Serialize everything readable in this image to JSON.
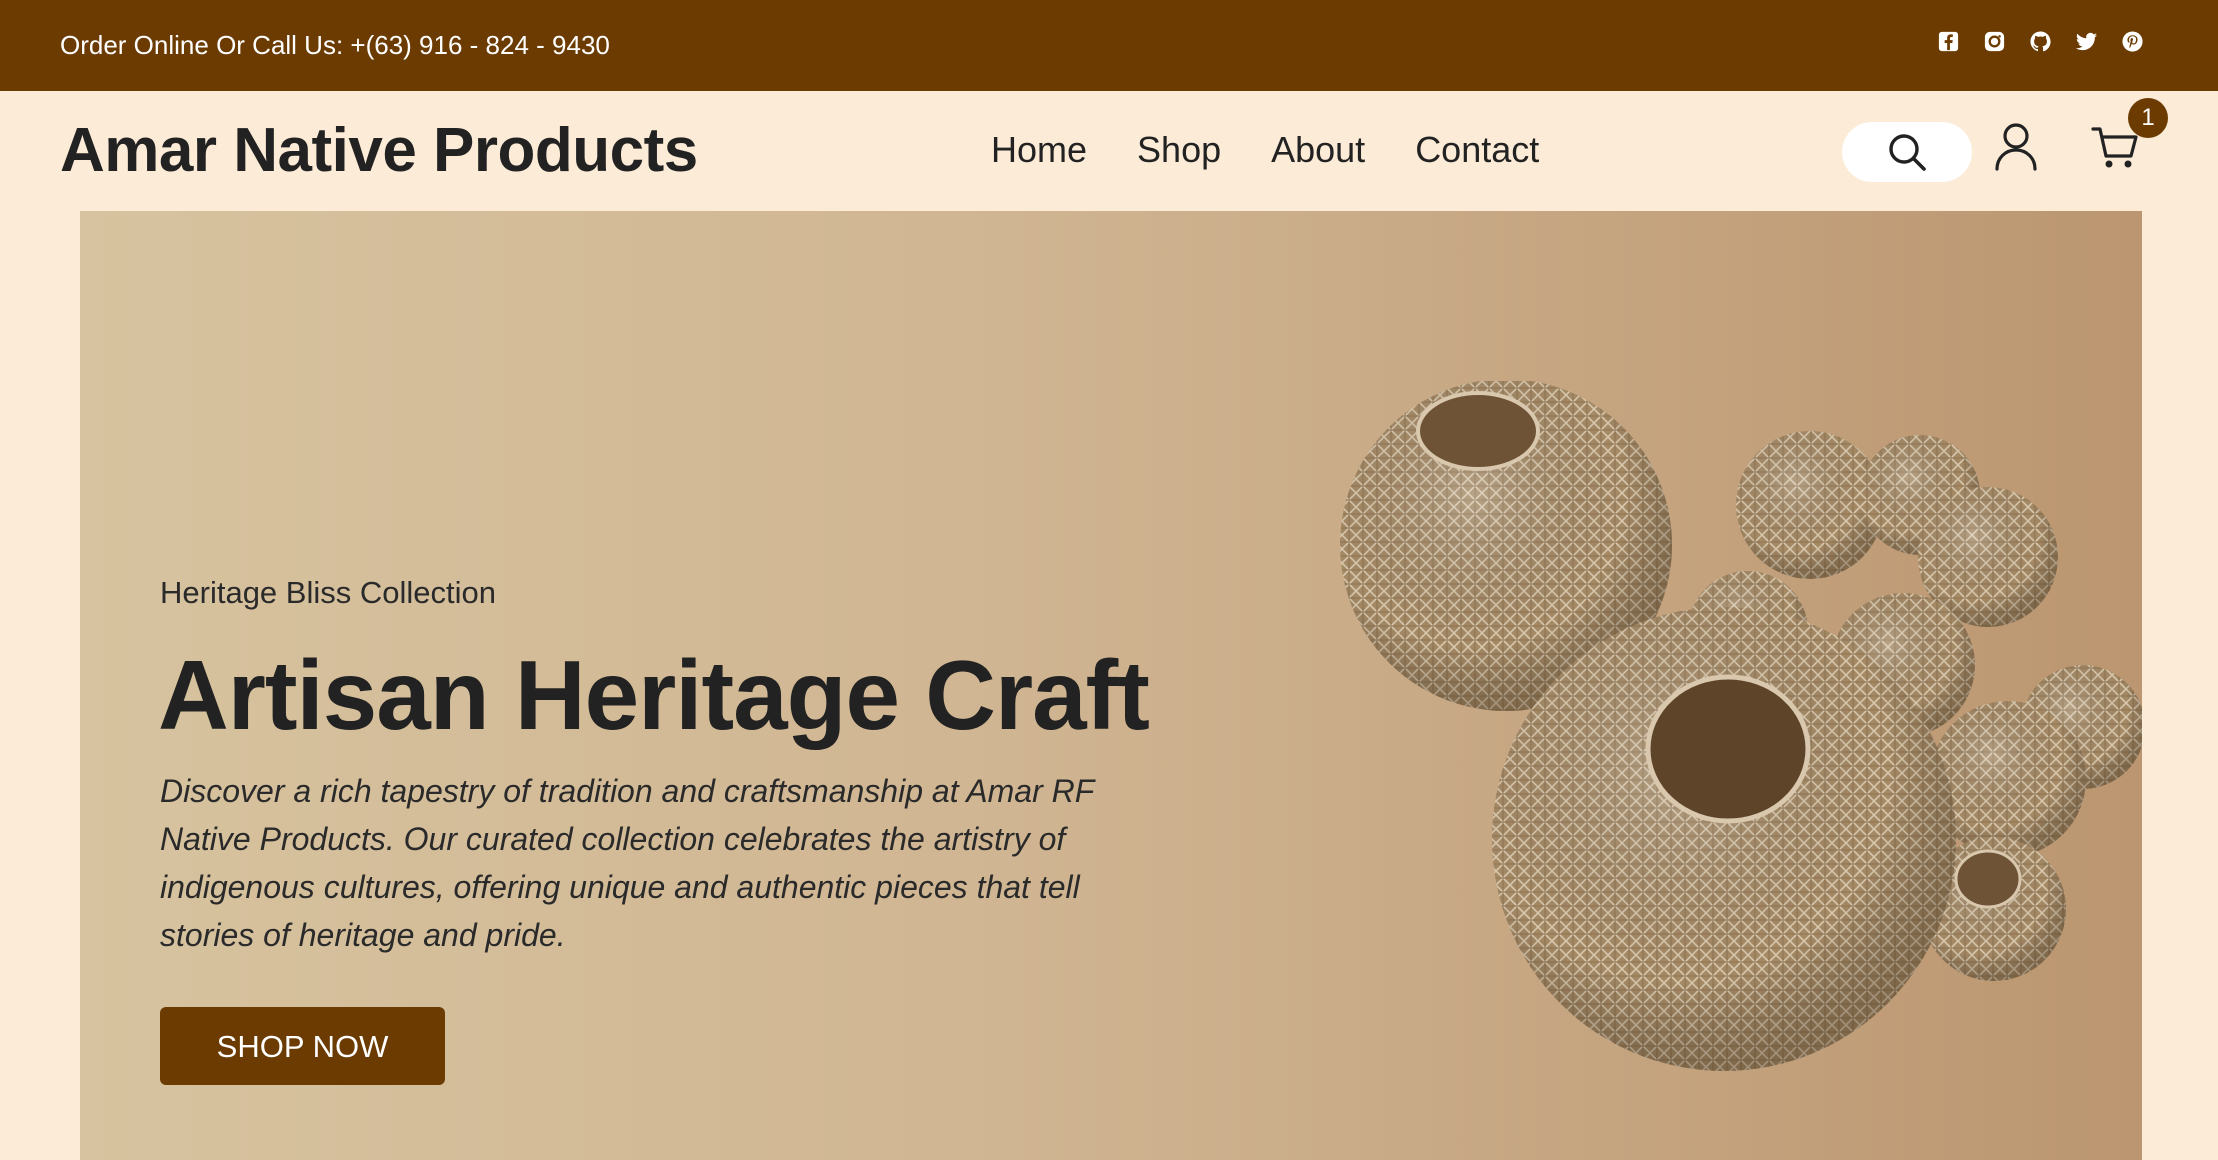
{
  "topbar": {
    "call_text": "Order Online Or Call Us: +(63) 916 - 824 - 9430",
    "social_icons": [
      "facebook-icon",
      "instagram-icon",
      "github-icon",
      "twitter-icon",
      "pinterest-icon"
    ]
  },
  "header": {
    "brand": "Amar Native Products",
    "nav": [
      "Home",
      "Shop",
      "About",
      "Contact"
    ],
    "cart_count": "1"
  },
  "hero": {
    "kicker": "Heritage Bliss Collection",
    "headline": "Artisan Heritage Craft",
    "description": "Discover a rich tapestry of tradition and craftsmanship at Amar RF Native Products. Our curated collection celebrates the artistry of indigenous cultures, offering unique and authentic pieces that tell stories of heritage and pride.",
    "cta": "SHOP NOW"
  },
  "colors": {
    "brand_brown": "#6b3b02",
    "page_bg": "#fbebd7",
    "hero_gradient_start": "#d7c39f",
    "hero_gradient_end": "#bb9670"
  }
}
